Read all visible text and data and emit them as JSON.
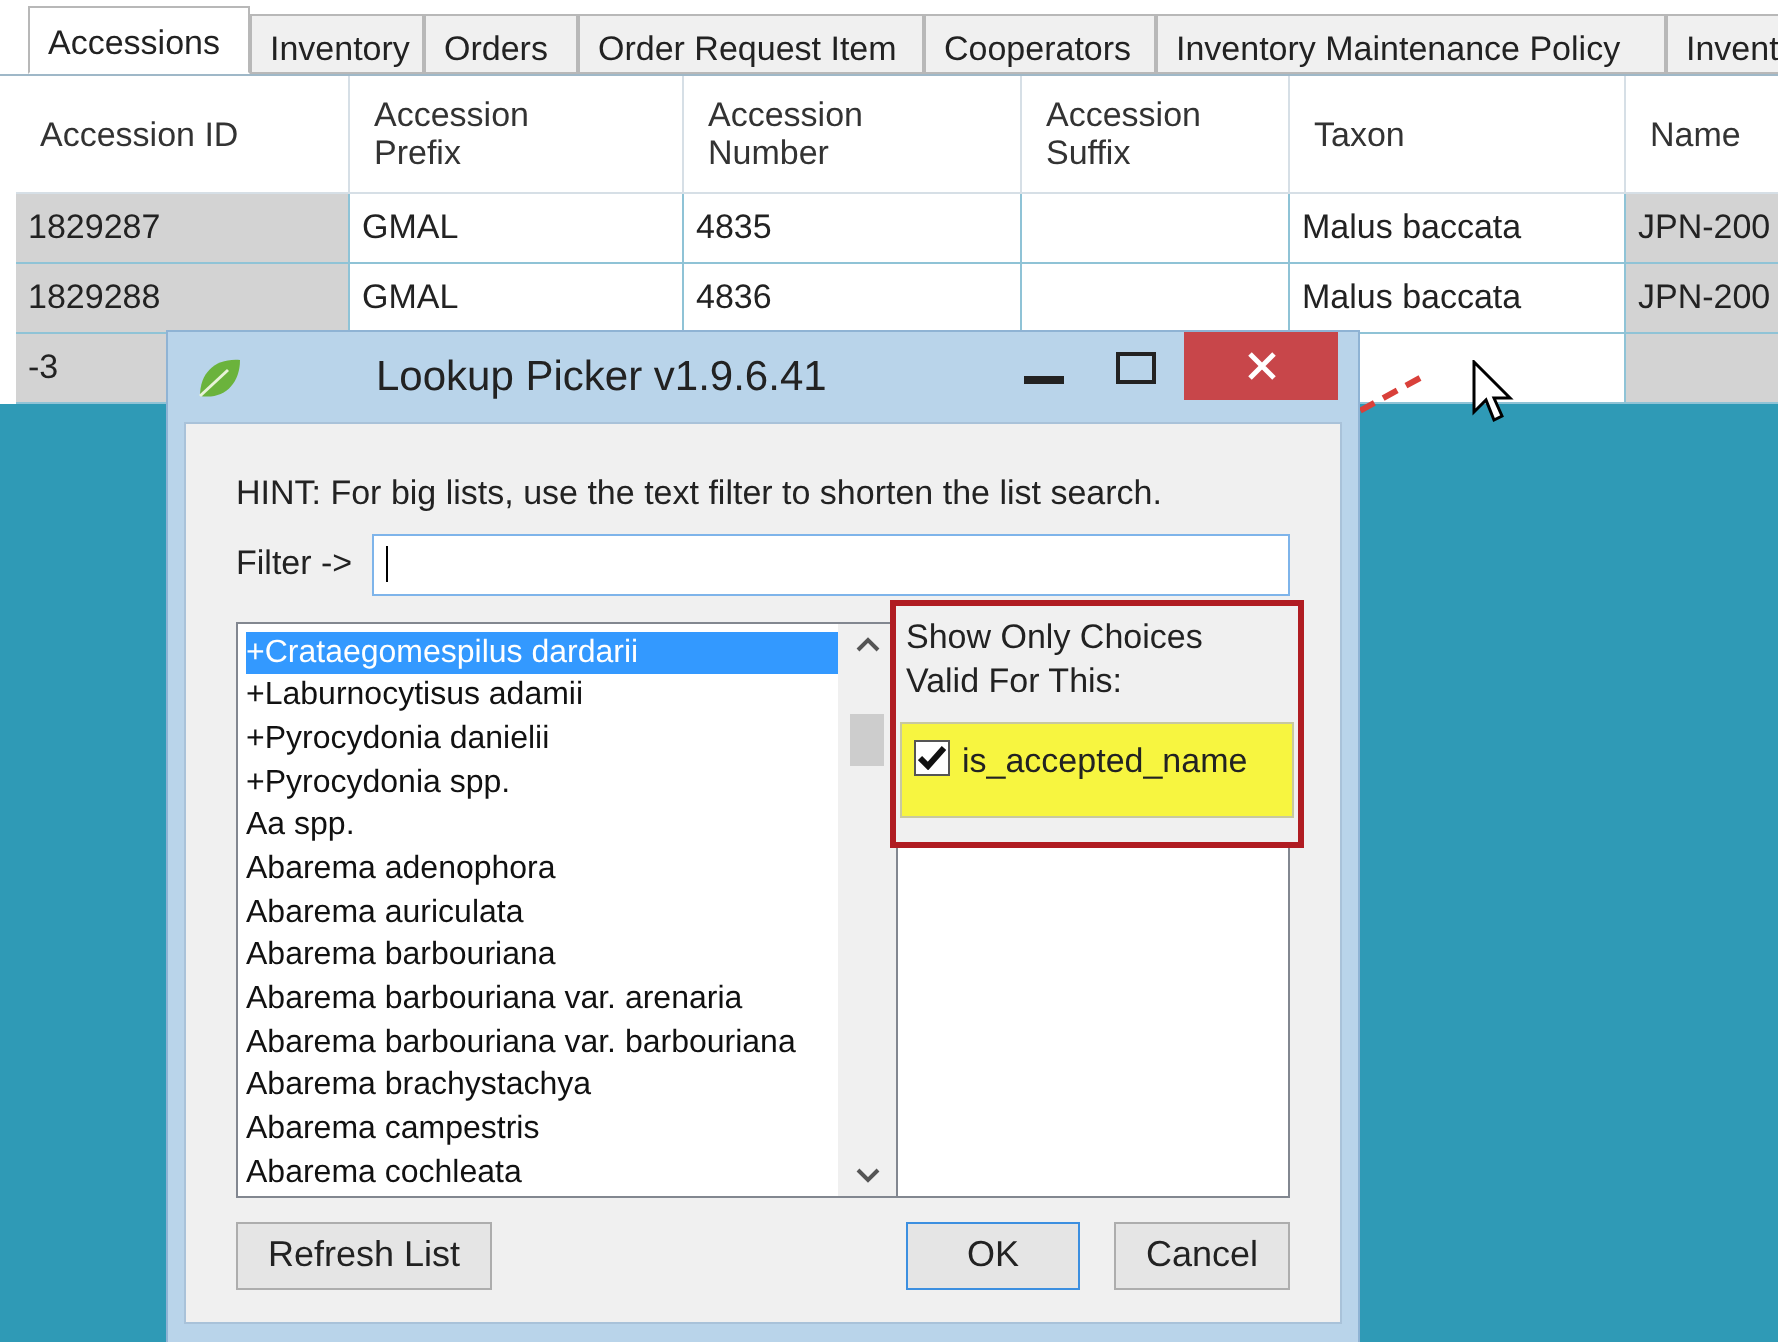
{
  "tabs": [
    {
      "label": "Accessions",
      "selected": true
    },
    {
      "label": "Inventory",
      "selected": false
    },
    {
      "label": "Orders",
      "selected": false
    },
    {
      "label": "Order Request Item",
      "selected": false
    },
    {
      "label": "Cooperators",
      "selected": false
    },
    {
      "label": "Inventory Maintenance Policy",
      "selected": false
    },
    {
      "label": "Invent",
      "selected": false
    }
  ],
  "table": {
    "columns": [
      "Accession ID",
      "Accession\nPrefix",
      "Accession\nNumber",
      "Accession\nSuffix",
      "Taxon",
      "Name"
    ],
    "rows": [
      [
        "1829287",
        "GMAL",
        "4835",
        "",
        "Malus baccata",
        "JPN-200"
      ],
      [
        "1829288",
        "GMAL",
        "4836",
        "",
        "Malus baccata",
        "JPN-200"
      ],
      [
        "-3",
        null,
        null,
        null,
        "",
        ""
      ]
    ]
  },
  "dialog": {
    "title": "Lookup Picker v1.9.6.41",
    "hint": "HINT: For big lists, use the text filter to shorten the list search.",
    "filter_label": "Filter ->",
    "items": [
      {
        "label": "+Crataegomespilus dardarii",
        "selected": true
      },
      {
        "label": "+Laburnocytisus adamii",
        "selected": false
      },
      {
        "label": "+Pyrocydonia danielii",
        "selected": false
      },
      {
        "label": "+Pyrocydonia spp.",
        "selected": false
      },
      {
        "label": "Aa spp.",
        "selected": false
      },
      {
        "label": "Abarema adenophora",
        "selected": false
      },
      {
        "label": "Abarema auriculata",
        "selected": false
      },
      {
        "label": "Abarema barbouriana",
        "selected": false
      },
      {
        "label": "Abarema barbouriana var. arenaria",
        "selected": false
      },
      {
        "label": "Abarema barbouriana var. barbouriana",
        "selected": false
      },
      {
        "label": "Abarema brachystachya",
        "selected": false
      },
      {
        "label": "Abarema campestris",
        "selected": false
      },
      {
        "label": "Abarema cochleata",
        "selected": false
      }
    ],
    "filter_heading": "Show Only Choices\nValid For This:",
    "choices": [
      {
        "label": "is_accepted_name",
        "checked": true
      }
    ],
    "buttons": [
      {
        "label": "Refresh List",
        "default": false
      },
      {
        "label": "OK",
        "default": true
      },
      {
        "label": "Cancel",
        "default": false
      }
    ]
  }
}
